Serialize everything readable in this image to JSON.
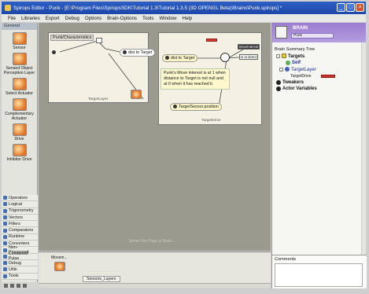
{
  "window": {
    "title": "Spirops Editor - Punk - [E:\\Program Files\\SpiropsSDK\\Tutorial 1.3\\Tutorial 1.3.5 (3D OPENGL Beta)\\Brains\\Punk.spirops] *",
    "controls": [
      "_",
      "□",
      "×"
    ]
  },
  "menu": [
    "File",
    "Libraries",
    "Export",
    "Debug",
    "Options",
    "Brain-Options",
    "Tools",
    "Window",
    "Help"
  ],
  "toolbox": {
    "header": "General",
    "tools": [
      {
        "label": "Sensor",
        "icon": "sensor-icon"
      },
      {
        "label": "Sensed Object Perception Layer",
        "icon": "perception-layer-icon"
      },
      {
        "label": "Select Actuator",
        "icon": "select-actuator-icon"
      },
      {
        "label": "Complementary Actuator",
        "icon": "complementary-actuator-icon"
      },
      {
        "label": "Drive",
        "icon": "drive-icon"
      },
      {
        "label": "Inhibitor Drive",
        "icon": "inhibitor-drive-icon"
      }
    ],
    "categories": [
      "Operators",
      "Logical",
      "Trigonometry",
      "Vectors",
      "Filters",
      "Comparators",
      "Runtime",
      "Converters",
      "Non-Processed",
      "Combined Pulse",
      "Debug",
      "Utils",
      "Tools"
    ]
  },
  "canvas": {
    "group1": {
      "title": "Punk/Characteristics",
      "caption": "TargetLayer",
      "nodes": [
        "dist to Target"
      ]
    },
    "group2": {
      "caption": "TargetDrive",
      "nodes": [
        "dist to Target",
        "TargetSensor.position"
      ],
      "note": "Punk's Move interest is at 1 when distance to Target is not null and at 0 when it has reached it.",
      "tags": [
        "MoveInterest",
        "Is at detect"
      ]
    },
    "overlay_text": "Some Hint Page of Brain ..."
  },
  "bottom_panel": {
    "item_label": "Movem...",
    "tab_label": "Sensors_Layers"
  },
  "right_panel": {
    "brain_name": "BRAIN",
    "brain_field": "Punk",
    "tree_title": "Brain Summary Tree",
    "tree": [
      {
        "label": "Targets",
        "level": 0,
        "bold": true
      },
      {
        "label": "Self",
        "level": 1,
        "bold": true
      },
      {
        "label": "TargetLayer",
        "level": 1,
        "bold": false
      },
      {
        "label": "TargetDrive",
        "level": 2,
        "bold": false
      },
      {
        "label": "Tweakers",
        "level": 0,
        "bold": true
      },
      {
        "label": "Actor Variables",
        "level": 0,
        "bold": true
      }
    ],
    "comments_label": "Comments"
  }
}
